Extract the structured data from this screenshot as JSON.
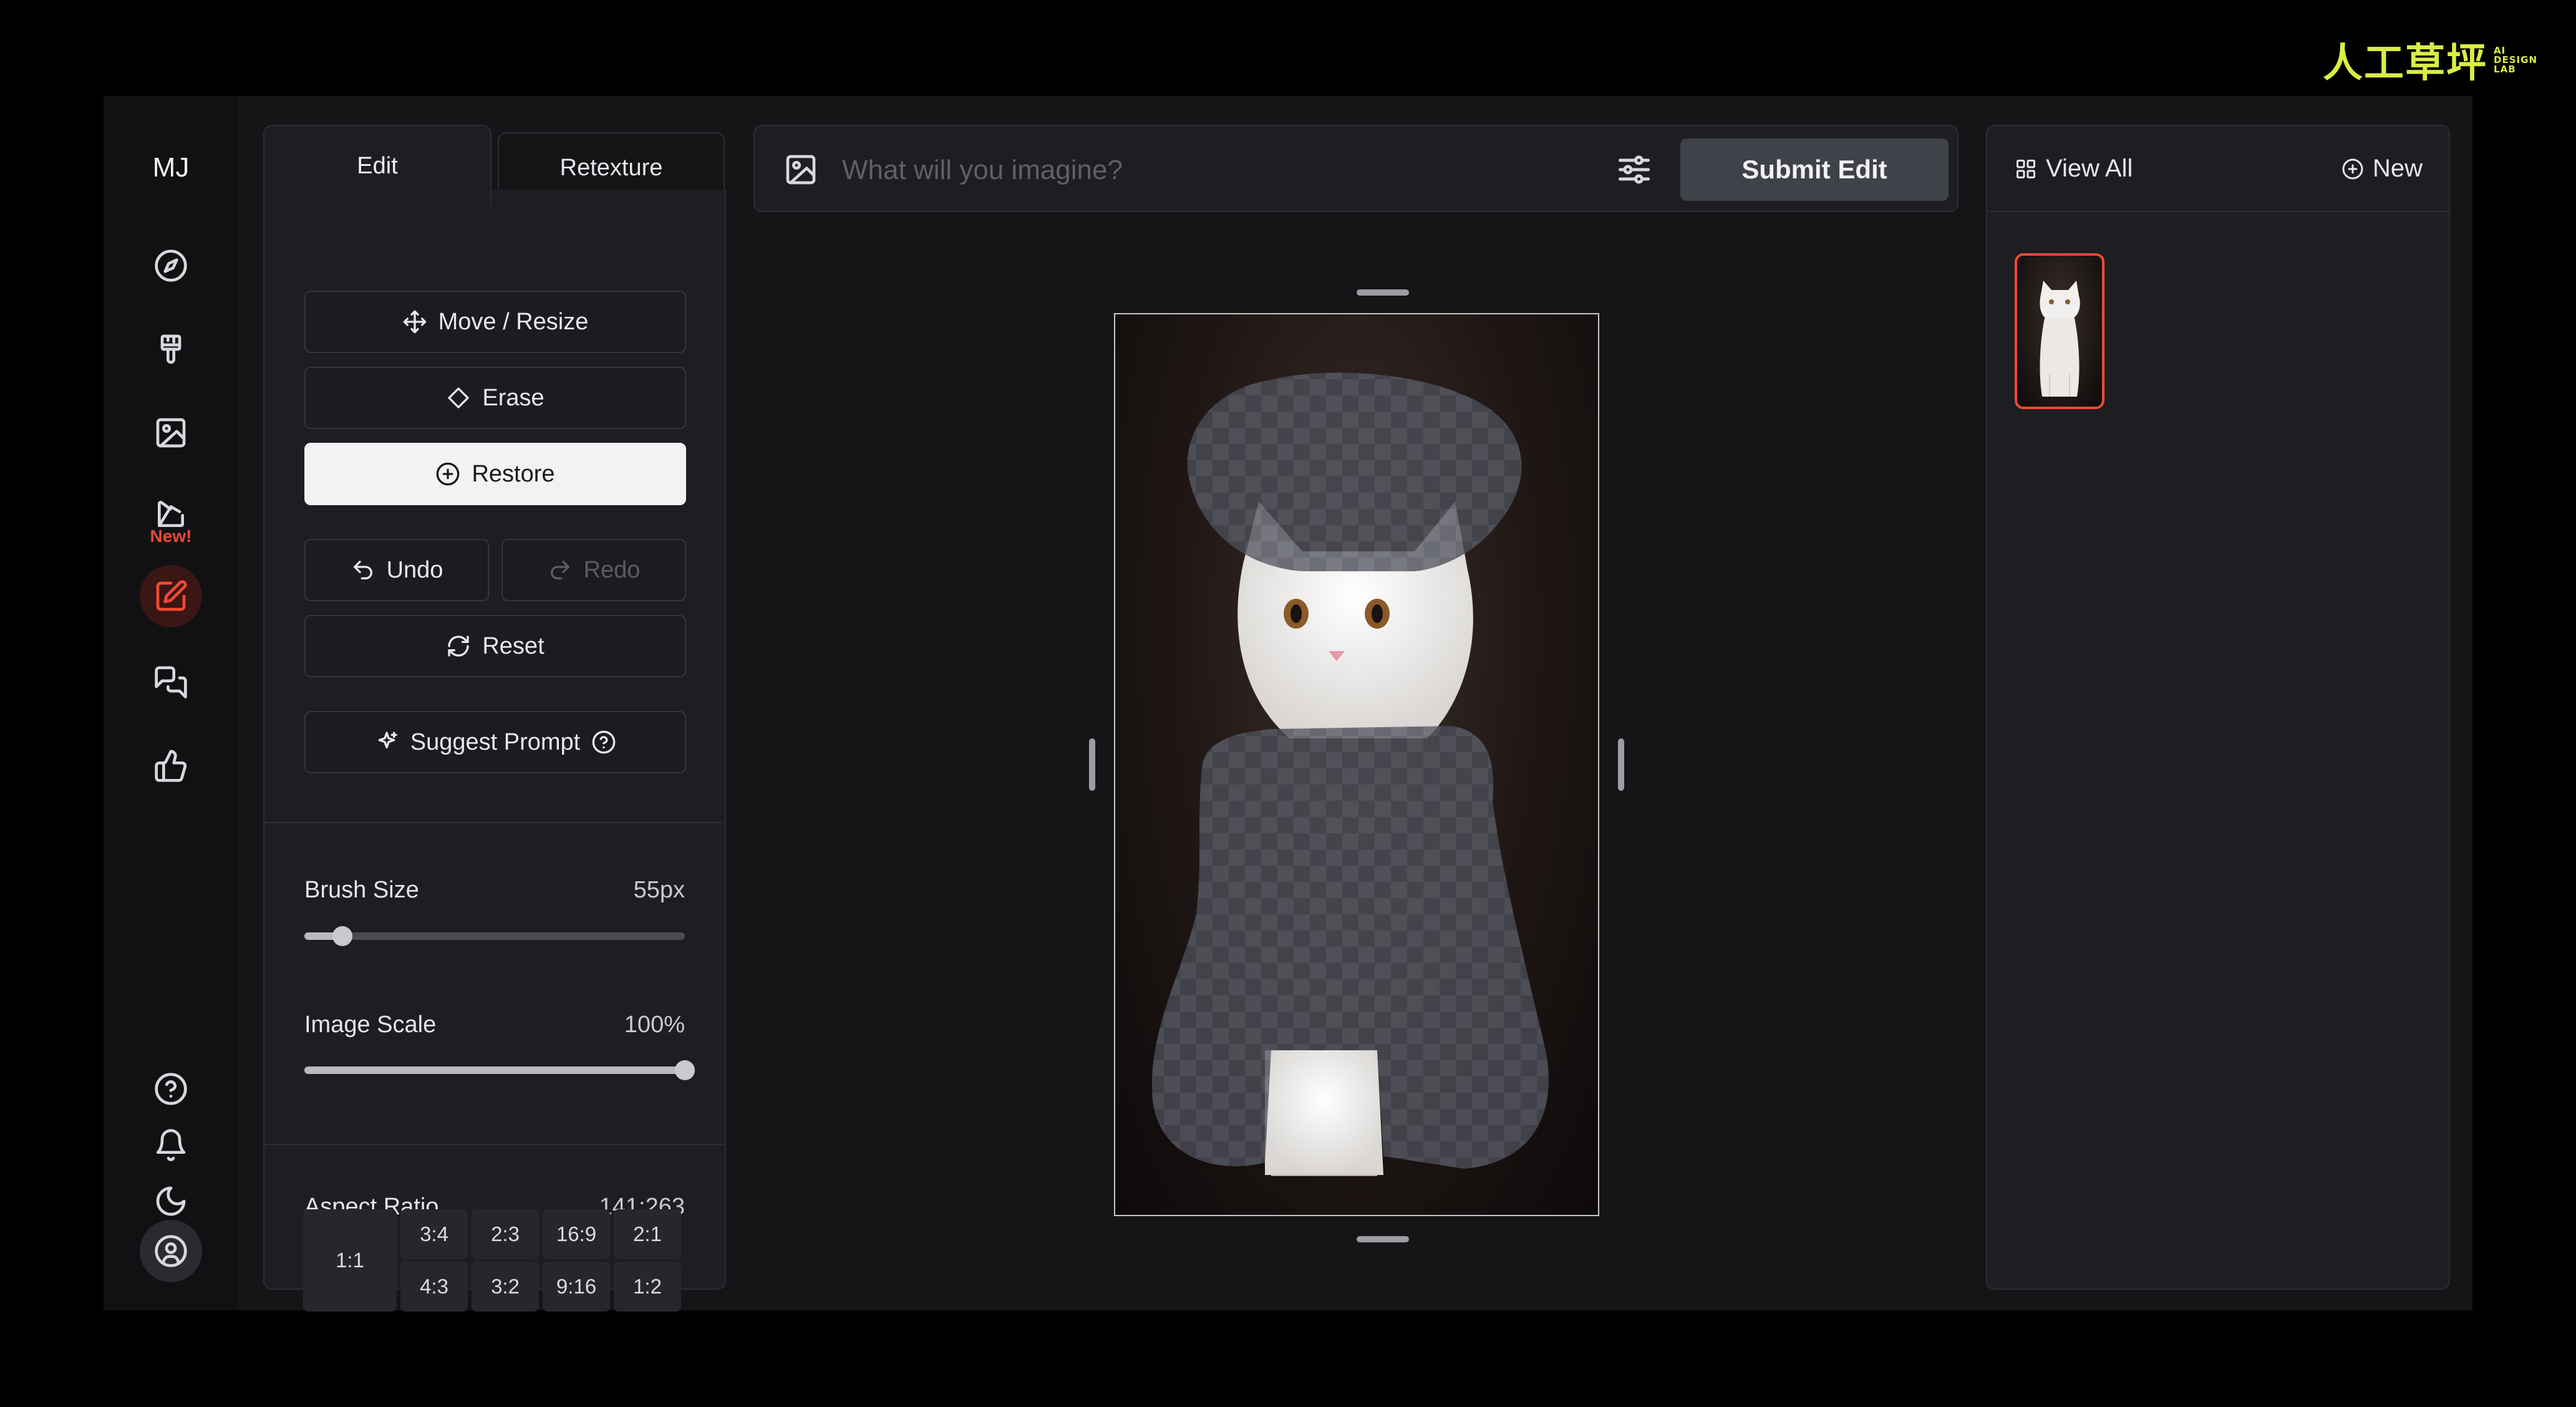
{
  "brand": {
    "zh": "人工草坪",
    "en_lines": [
      "AI",
      "DESIGN",
      "LAB"
    ],
    "color": "#d9ee44"
  },
  "rail": {
    "logo": "MJ",
    "new_badge": "New!",
    "accent": "#f24a31",
    "icons": [
      "compass-icon",
      "paintbrush-icon",
      "image-icon",
      "layers-icon",
      "edit-icon",
      "chat-icon",
      "thumbs-up-icon",
      "help-icon",
      "bell-icon",
      "moon-icon",
      "user-circle-icon"
    ]
  },
  "edit_panel": {
    "tabs": {
      "edit": "Edit",
      "retexture": "Retexture"
    },
    "tools": {
      "move_resize": "Move / Resize",
      "erase": "Erase",
      "restore": "Restore"
    },
    "history": {
      "undo": "Undo",
      "redo": "Redo",
      "reset": "Reset"
    },
    "suggest_prompt": "Suggest Prompt",
    "brush_size": {
      "label": "Brush Size",
      "value": "55px",
      "fraction": 0.1
    },
    "image_scale": {
      "label": "Image Scale",
      "value": "100%",
      "fraction": 1.0
    },
    "aspect_ratio": {
      "label": "Aspect Ratio",
      "value": "141:263",
      "square": "1:1",
      "top_row": [
        "3:4",
        "2:3",
        "16:9",
        "2:1"
      ],
      "bottom_row": [
        "4:3",
        "3:2",
        "9:16",
        "1:2"
      ]
    }
  },
  "prompt": {
    "placeholder": "What will you imagine?",
    "submit": "Submit Edit"
  },
  "gallery": {
    "view_all": "View All",
    "new": "New"
  }
}
